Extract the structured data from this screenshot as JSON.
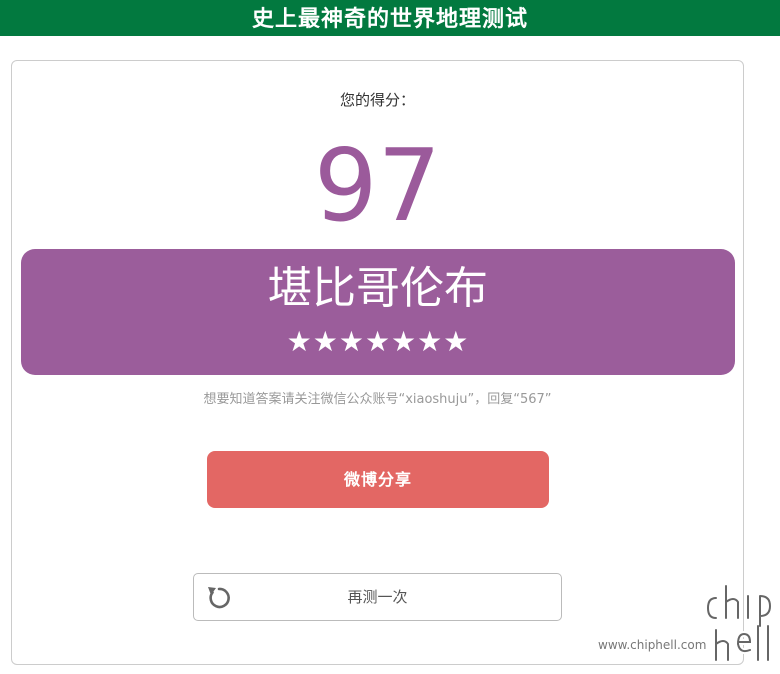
{
  "header": {
    "title": "史上最神奇的世界地理测试"
  },
  "result": {
    "score_label": "您的得分：",
    "score": "97",
    "rank_title": "堪比哥伦布",
    "stars": "★★★★★★★",
    "star_count": 7,
    "hint": "想要知道答案请关注微信公众账号“xiaoshuju”，回复“567”"
  },
  "actions": {
    "share_label": "微博分享",
    "retry_label": "再测一次"
  },
  "watermark": {
    "site": "www.chiphell.com"
  },
  "colors": {
    "header_bg": "#02793f",
    "accent_purple": "#9b5d9b",
    "share_red": "#e36764"
  }
}
